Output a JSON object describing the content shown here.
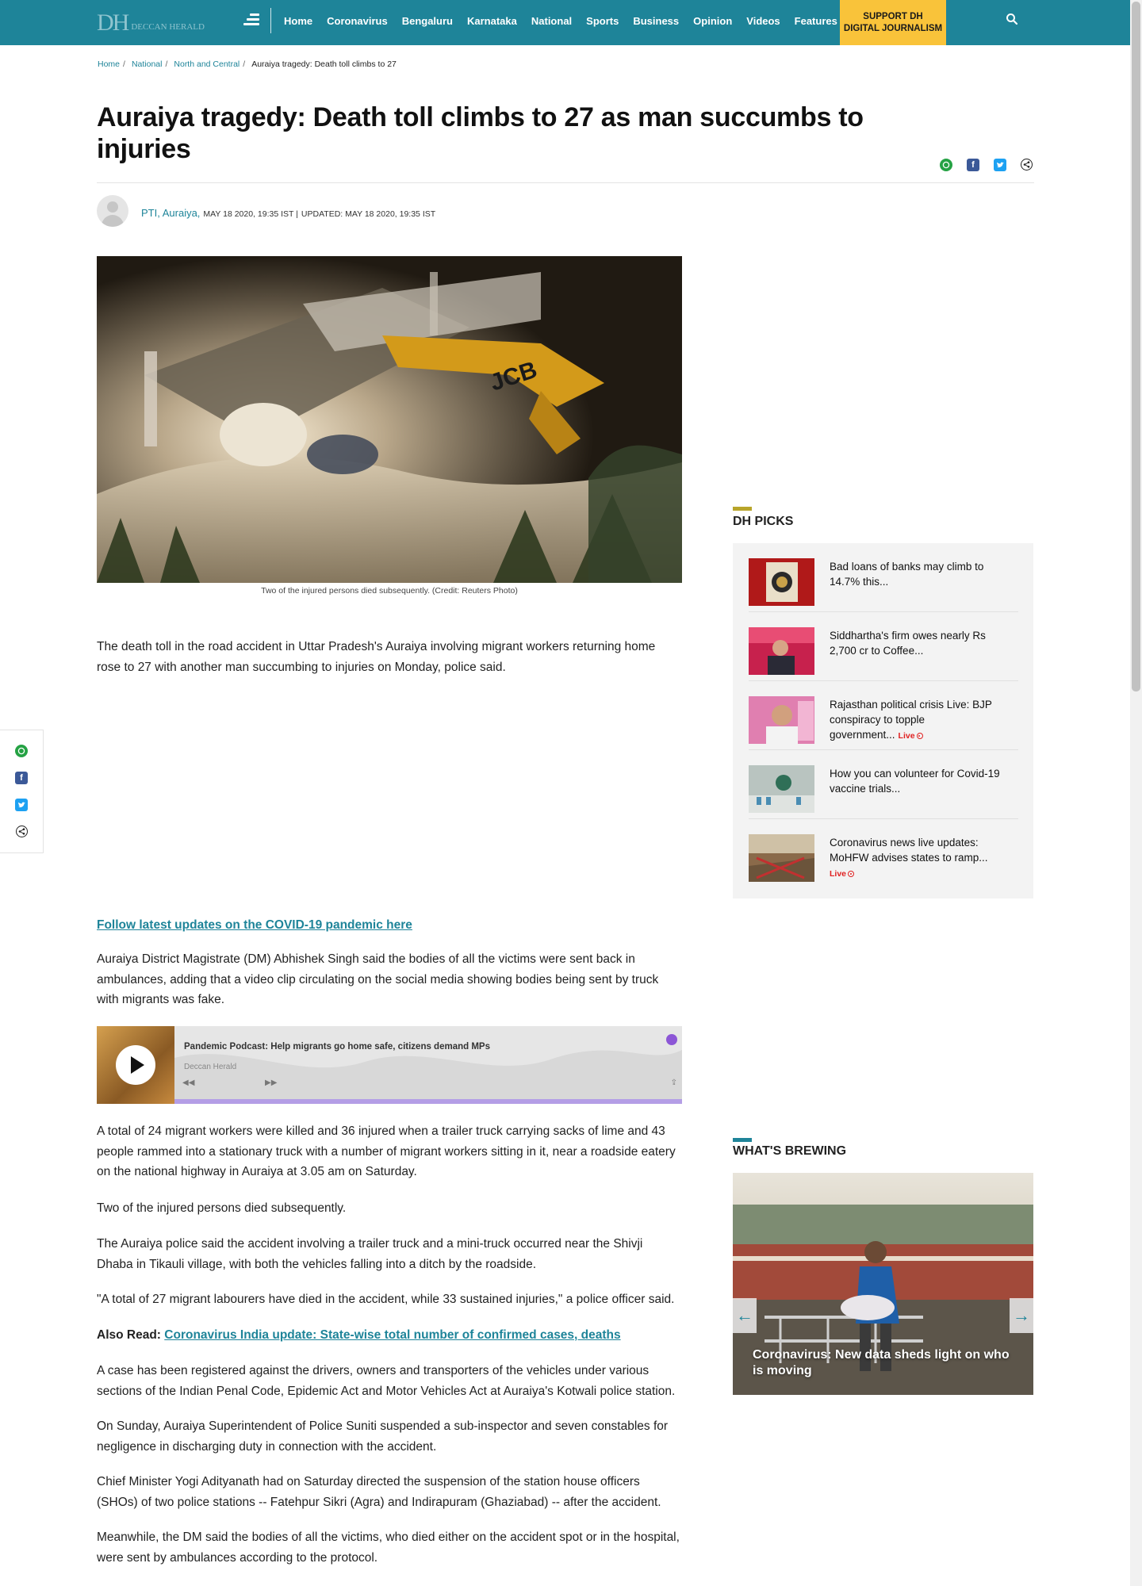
{
  "nav": {
    "logo_mark": "DH",
    "logo_name": "DECCAN HERALD",
    "links": [
      "Home",
      "Coronavirus",
      "Bengaluru",
      "Karnataka",
      "National",
      "Sports",
      "Business",
      "Opinion",
      "Videos",
      "Features"
    ],
    "support_line1": "SUPPORT DH",
    "support_line2": "DIGITAL JOURNALISM"
  },
  "breadcrumb": {
    "items": [
      "Home",
      "National",
      "North and Central"
    ],
    "current": "Auraiya tragedy: Death toll climbs to 27"
  },
  "article": {
    "headline": "Auraiya tragedy: Death toll climbs to 27 as man succumbs to injuries",
    "author": "PTI, Auraiya,",
    "published": "MAY 18 2020, 19:35 IST |",
    "updated": "UPDATED: MAY 18 2020, 19:35 IST",
    "image_caption": "Two of the injured persons died subsequently. (Credit: Reuters Photo)",
    "image_text": "JCB",
    "p1": "The death toll in the road accident in Uttar Pradesh's Auraiya involving migrant workers returning home rose to 27 with another man succumbing to injuries on Monday, police said.",
    "follow_link": "Follow latest updates on the COVID-19 pandemic here",
    "p2": "Auraiya District Magistrate (DM) Abhishek Singh said the bodies of all the victims were sent back in ambulances, adding that a video clip circulating on the social media showing bodies being sent by truck with migrants was fake.",
    "p3": "A total of 24 migrant workers were killed and 36 injured when a trailer truck carrying sacks of lime and 43 people rammed into a stationary truck with a number of migrant workers sitting in it, near a roadside eatery on the national highway in Auraiya at 3.05 am on Saturday.",
    "p4": "Two of the injured persons died subsequently.",
    "p5": "The Auraiya police said the accident involving a trailer truck and a mini-truck occurred near the Shivji Dhaba in Tikauli village, with both the vehicles falling into a ditch by the roadside.",
    "p6": "\"A total of 27 migrant labourers have died in the accident, while 33 sustained injuries,\" a police officer said.",
    "also_read_label": "Also Read:",
    "also_read_link": "Coronavirus India update: State-wise total number of confirmed cases, deaths",
    "p7": "A case has been registered against the drivers, owners and transporters of the vehicles under various sections of the Indian Penal Code, Epidemic Act and Motor Vehicles Act at Auraiya's Kotwali police station.",
    "p8": "On Sunday, Auraiya Superintendent of Police Suniti suspended a sub-inspector and seven constables for negligence in discharging duty in connection with the accident.",
    "p9": "Chief Minister Yogi Adityanath had on Saturday directed the suspension of the station house officers (SHOs) of two police stations -- Fatehpur Sikri (Agra) and Indirapuram (Ghaziabad) -- after the accident.",
    "p10": "Meanwhile, the DM said the bodies of all the victims, who died either on the accident spot or in the hospital, were sent by ambulances according to the protocol."
  },
  "podcast": {
    "title": "Pandemic Podcast: Help migrants go home safe, citizens demand MPs",
    "source": "Deccan Herald",
    "rewind": "◀◀",
    "forward": "▶▶",
    "share": "⇪"
  },
  "sidebar": {
    "picks_title": "DH PICKS",
    "picks": [
      {
        "title": "Bad loans of banks may climb to 14.7% this...",
        "live": ""
      },
      {
        "title": "Siddhartha's firm owes nearly Rs 2,700 cr to Coffee...",
        "live": ""
      },
      {
        "title": "Rajasthan political crisis Live: BJP conspiracy to topple government...",
        "live": "Live"
      },
      {
        "title": "How you can volunteer for Covid-19 vaccine trials...",
        "live": ""
      },
      {
        "title": "Coronavirus news live updates: MoHFW advises states to ramp...",
        "live": "Live"
      }
    ],
    "brewing_title": "WHAT'S BREWING",
    "brewing_caption": "Coronavirus: New data sheds light on who is moving"
  },
  "colors": {
    "brand": "#1e8499",
    "accent_yellow": "#f9c33a",
    "picks_bar": "#b8a52a",
    "live_red": "#e02020"
  }
}
